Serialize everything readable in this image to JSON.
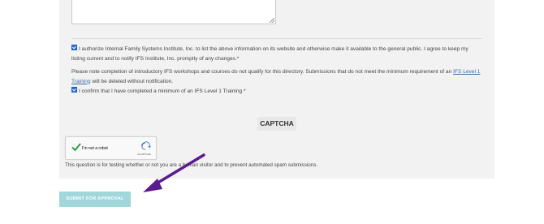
{
  "form": {
    "authorize_text": "I authorize Internal Family Systems Institute, Inc. to list the above information on its website and otherwise make it available to the general public. I agree to keep my listing current and to notify IFS Institute, Inc. promptly of any changes.*",
    "note_text_before": "Please note completion of introductory IFS workshops and courses do not qualify for this directory. Submissions that do not meet the minimum requirement of an ",
    "note_link": "IFS Level 1 Training",
    "note_text_after": " will be deleted without notification.",
    "confirm_text": "I confirm that I have completed a minimum of an IFS Level 1 Training *",
    "authorize_checked": true,
    "confirm_checked": true
  },
  "captcha": {
    "title": "CAPTCHA",
    "recaptcha_label": "I'm not a robot",
    "recaptcha_brand": "reCAPTCHA",
    "description": "This question is for testing whether or not you are a human visitor and to prevent automated spam submissions."
  },
  "submit": {
    "label": "SUBMIT FOR APPROVAL"
  },
  "colors": {
    "panel": "#f2f2f2",
    "submit": "#9fd7db",
    "checkbox": "#2a6fdb",
    "link": "#3a6ea5",
    "annotation_arrow": "#5b1a8e"
  }
}
